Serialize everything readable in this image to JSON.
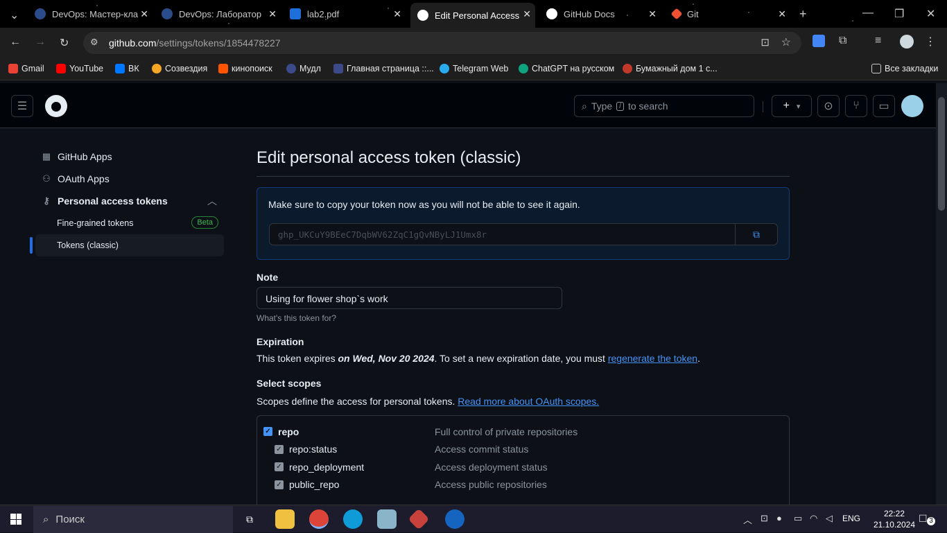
{
  "browser": {
    "tabs": [
      {
        "title": "DevOps: Мастер-кла",
        "color": "#2b4c8a"
      },
      {
        "title": "DevOps: Лаборатор",
        "color": "#2b4c8a"
      },
      {
        "title": "lab2.pdf",
        "color": "#1e6fd9"
      },
      {
        "title": "Edit Personal Access",
        "color": "#ffffff"
      },
      {
        "title": "GitHub Docs",
        "color": "#ffffff"
      },
      {
        "title": "Git",
        "color": "#f05133"
      }
    ],
    "url_host": "github.com",
    "url_path": "/settings/tokens/1854478227",
    "bookmarks": [
      {
        "label": "Gmail",
        "color": "#ea4335"
      },
      {
        "label": "YouTube",
        "color": "#ff0000"
      },
      {
        "label": "ВК",
        "color": "#0077ff"
      },
      {
        "label": "Созвездия",
        "color": "#f5a623"
      },
      {
        "label": "кинопоиск",
        "color": "#ff5500"
      },
      {
        "label": "Мудл",
        "color": "#3c4a8a"
      },
      {
        "label": "Главная страница ::...",
        "color": "#3c4a8a"
      },
      {
        "label": "Telegram Web",
        "color": "#2aabee"
      },
      {
        "label": "ChatGPT на русском",
        "color": "#10a37f"
      },
      {
        "label": "Бумажный дом 1 с...",
        "color": "#c0392b"
      }
    ],
    "all_bookmarks": "Все закладки"
  },
  "header": {
    "search_prefix": "Type",
    "search_key": "/",
    "search_suffix": "to search",
    "plus": "+",
    "caret": "▾"
  },
  "sidebar": {
    "items": [
      {
        "label": "GitHub Apps",
        "icon": "grid-icon"
      },
      {
        "label": "OAuth Apps",
        "icon": "person-icon"
      },
      {
        "label": "Personal access tokens",
        "icon": "key-icon"
      }
    ],
    "sub": [
      {
        "label": "Fine-grained tokens",
        "badge": "Beta"
      },
      {
        "label": "Tokens (classic)"
      }
    ]
  },
  "main": {
    "title": "Edit personal access token (classic)",
    "flash_message": "Make sure to copy your token now as you will not be able to see it again.",
    "token": "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",
    "note_label": "Note",
    "note_value": "Using for flower shop`s work",
    "note_hint": "What's this token for?",
    "expiration_label": "Expiration",
    "exp_text1": "This token expires ",
    "exp_date": "on Wed, Nov 20 2024",
    "exp_text2": ". To set a new expiration date, you must ",
    "exp_link": "regenerate the token",
    "exp_end": ".",
    "scopes_label": "Select scopes",
    "scopes_text": "Scopes define the access for personal tokens. ",
    "scopes_link": "Read more about OAuth scopes.",
    "scopes": [
      {
        "name": "repo",
        "desc": "Full control of private repositories",
        "child": false
      },
      {
        "name": "repo:status",
        "desc": "Access commit status",
        "child": true
      },
      {
        "name": "repo_deployment",
        "desc": "Access deployment status",
        "child": true
      },
      {
        "name": "public_repo",
        "desc": "Access public repositories",
        "child": true
      }
    ]
  },
  "taskbar": {
    "search": "Поиск",
    "lang": "ENG",
    "time": "22:22",
    "date": "21.10.2024",
    "notifications": "3"
  }
}
